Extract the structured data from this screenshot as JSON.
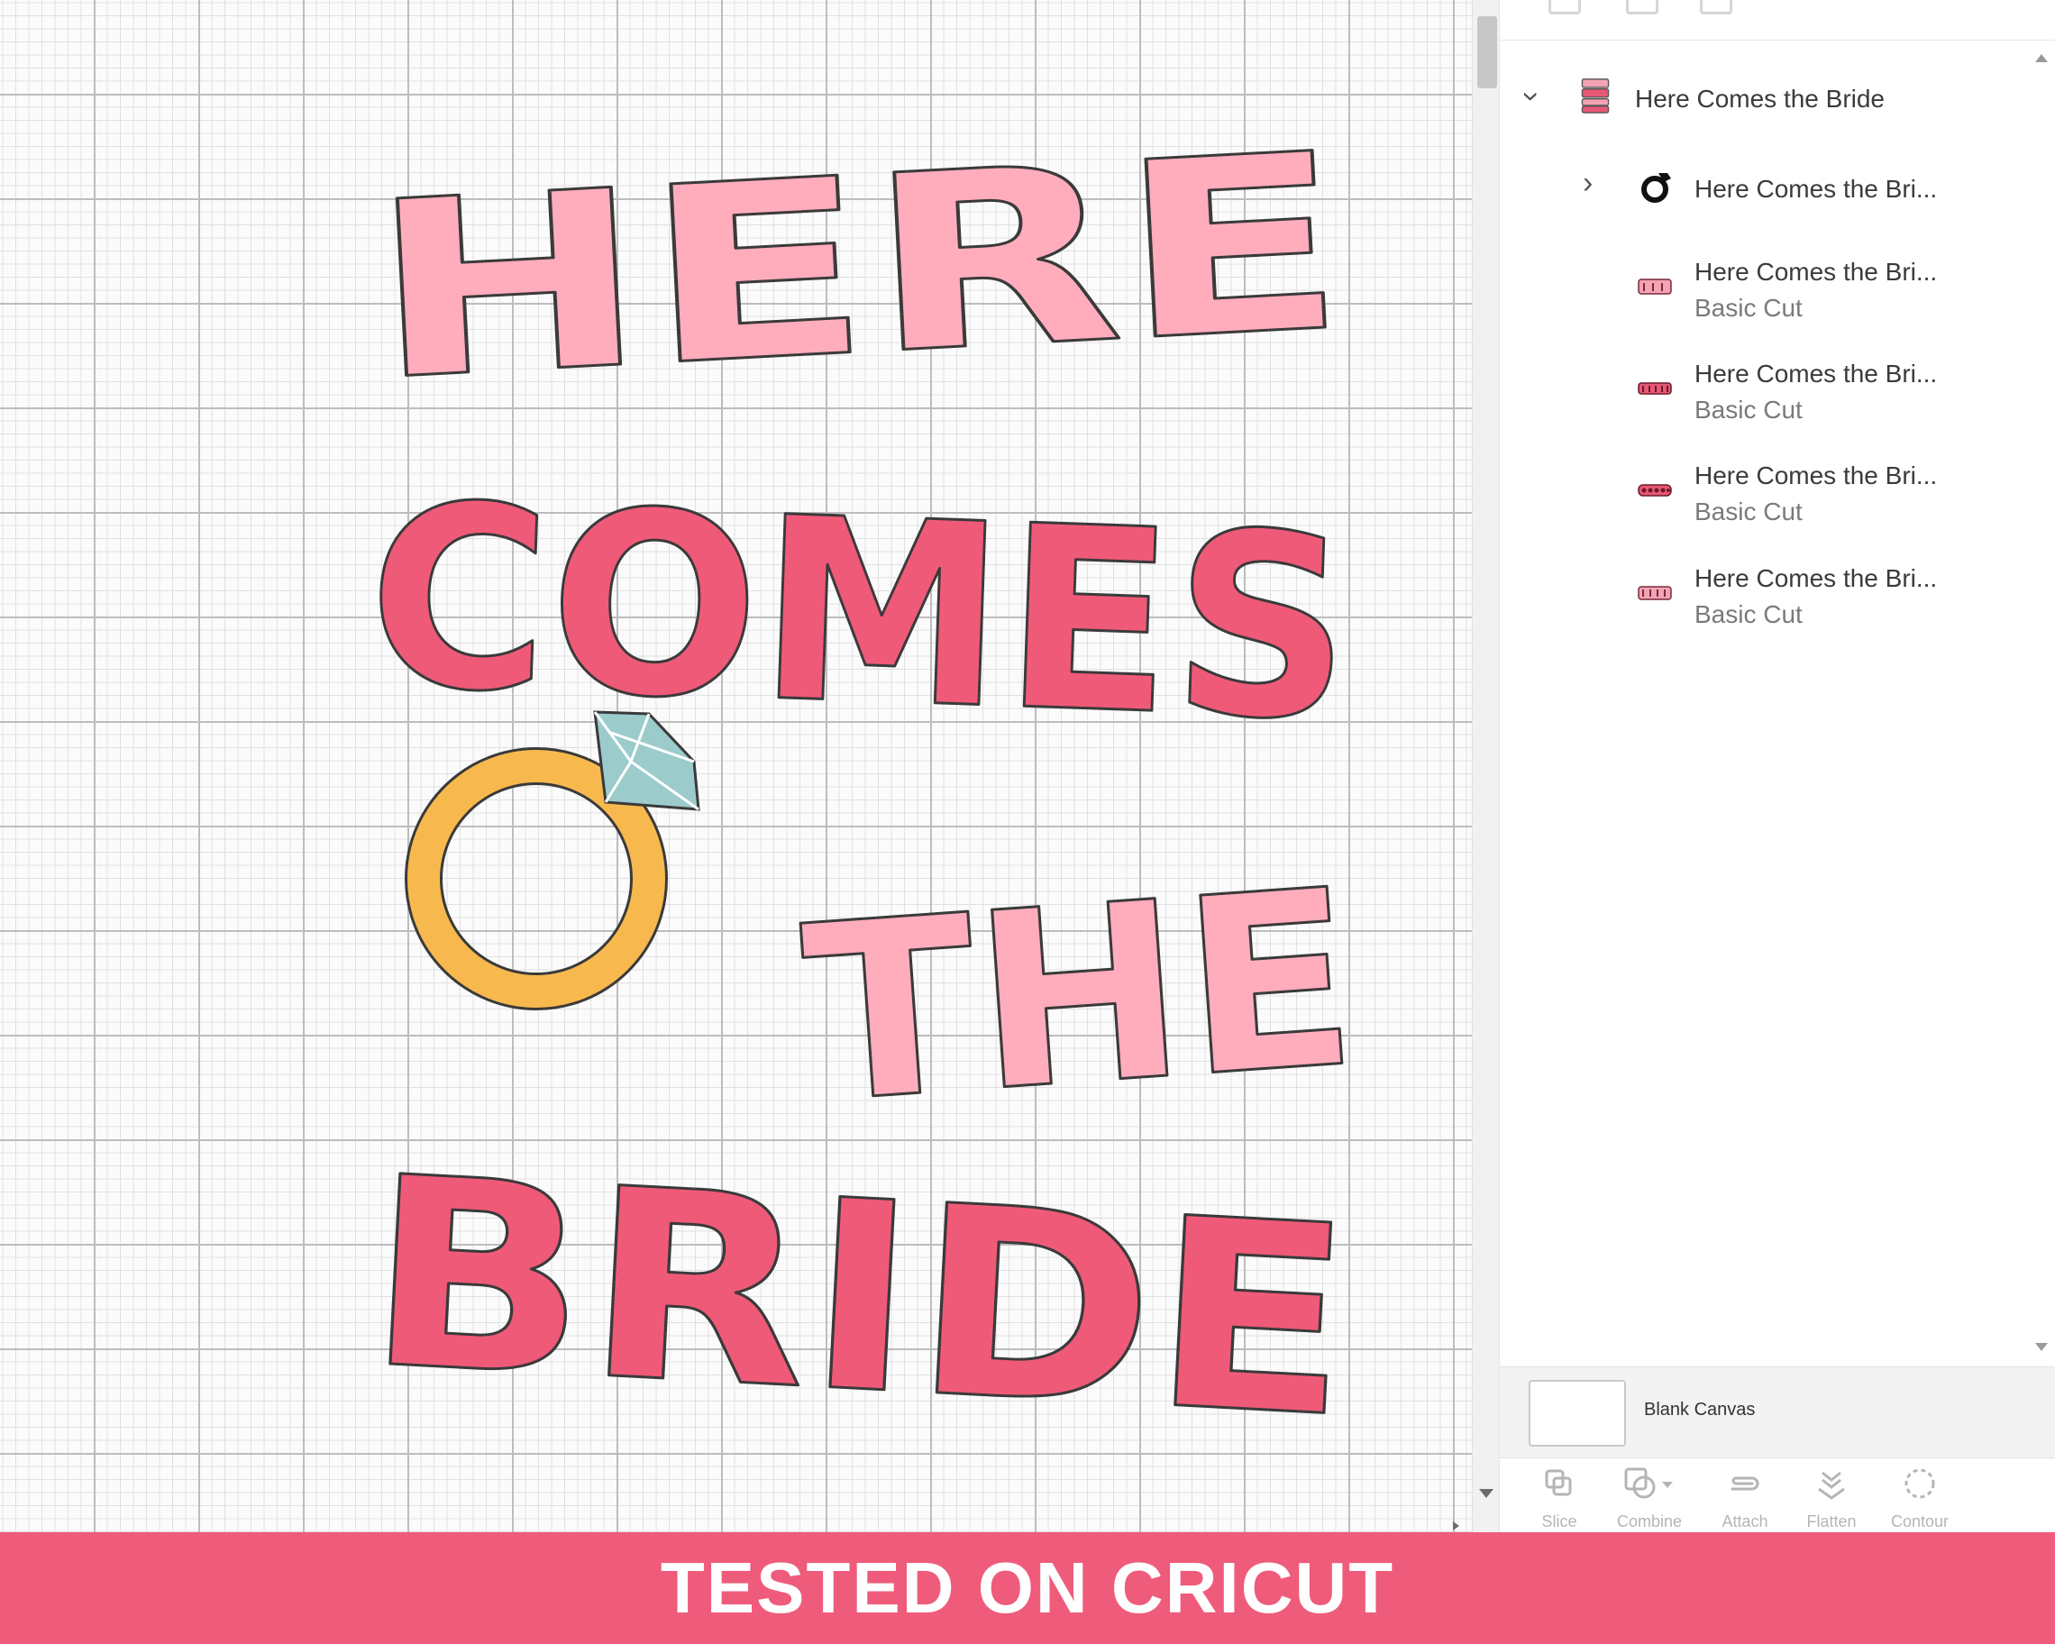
{
  "design": {
    "line1": "HERE",
    "line2": "COMES",
    "line3": "THE",
    "line4": "BRIDE",
    "colors": {
      "light_pink": "#ffadbc",
      "dark_pink": "#f05a79",
      "gold": "#f7b94e",
      "diamond": "#9ccbcc",
      "outline": "#3a3a3a"
    }
  },
  "layers_panel": {
    "group": {
      "name": "Here Comes the Bride",
      "expanded": true
    },
    "items": [
      {
        "name": "Here Comes the Bri...",
        "sub": "",
        "thumb": "ring-thumb-icon",
        "has_children": true
      },
      {
        "name": "Here Comes the Bri...",
        "sub": "Basic Cut",
        "thumb": "the-thumb-icon",
        "has_children": false
      },
      {
        "name": "Here Comes the Bri...",
        "sub": "Basic Cut",
        "thumb": "bride-thumb-icon",
        "has_children": false
      },
      {
        "name": "Here Comes the Bri...",
        "sub": "Basic Cut",
        "thumb": "comes-thumb-icon",
        "has_children": false
      },
      {
        "name": "Here Comes the Bri...",
        "sub": "Basic Cut",
        "thumb": "here-thumb-icon",
        "has_children": false
      }
    ],
    "blank_canvas": "Blank Canvas"
  },
  "toolbar": {
    "slice": "Slice",
    "combine": "Combine",
    "attach": "Attach",
    "flatten": "Flatten",
    "contour": "Contour"
  },
  "banner": {
    "text": "TESTED ON CRICUT",
    "color": "#ef5b7b"
  }
}
